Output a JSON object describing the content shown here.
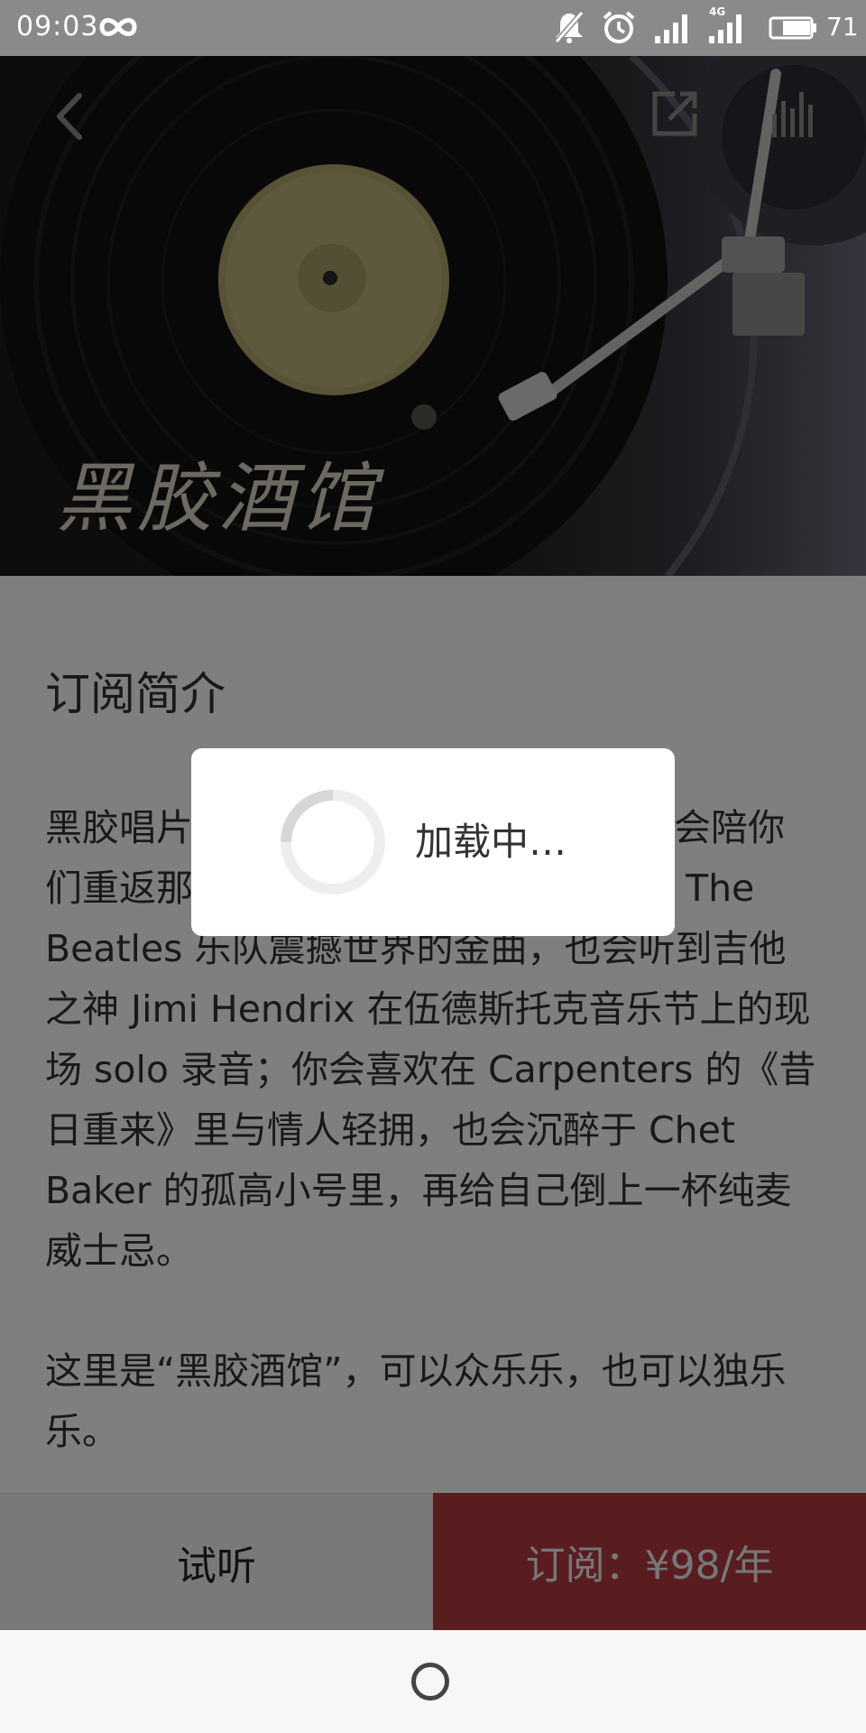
{
  "status_bar": {
    "time": "09:03",
    "battery": "71",
    "network": "4G",
    "icons": [
      "infinity-icon",
      "mute-icon",
      "alarm-icon",
      "signal-icon",
      "signal-4g-icon",
      "battery-icon"
    ]
  },
  "header": {
    "icons": [
      "back-icon",
      "share-icon",
      "playing-indicator-icon"
    ]
  },
  "hero": {
    "title": "黑胶酒馆"
  },
  "content": {
    "section_title": "订阅简介",
    "paragraph_1": "黑胶唱片是时光的载体，在这里，我们会陪你们重返那个伟大的年代，你会听到来自 The Beatles 乐队震撼世界的金曲，也会听到吉他之神 Jimi Hendrix 在伍德斯托克音乐节上的现场 solo 录音；你会喜欢在 Carpenters 的《昔日重来》里与情人轻拥，也会沉醉于 Chet Baker 的孤高小号里，再给自己倒上一杯纯麦威士忌。",
    "paragraph_2": "这里是“黑胶酒馆”，可以众乐乐，也可以独乐乐。"
  },
  "actions": {
    "trial_label": "试听",
    "subscribe_label": "订阅：¥98/年"
  },
  "loading": {
    "text": "加载中…"
  },
  "colors": {
    "status_bar": "#8a8a8a",
    "subscribe_accent": "#b33b41",
    "overlay": "rgba(0,0,0,0.5)"
  }
}
